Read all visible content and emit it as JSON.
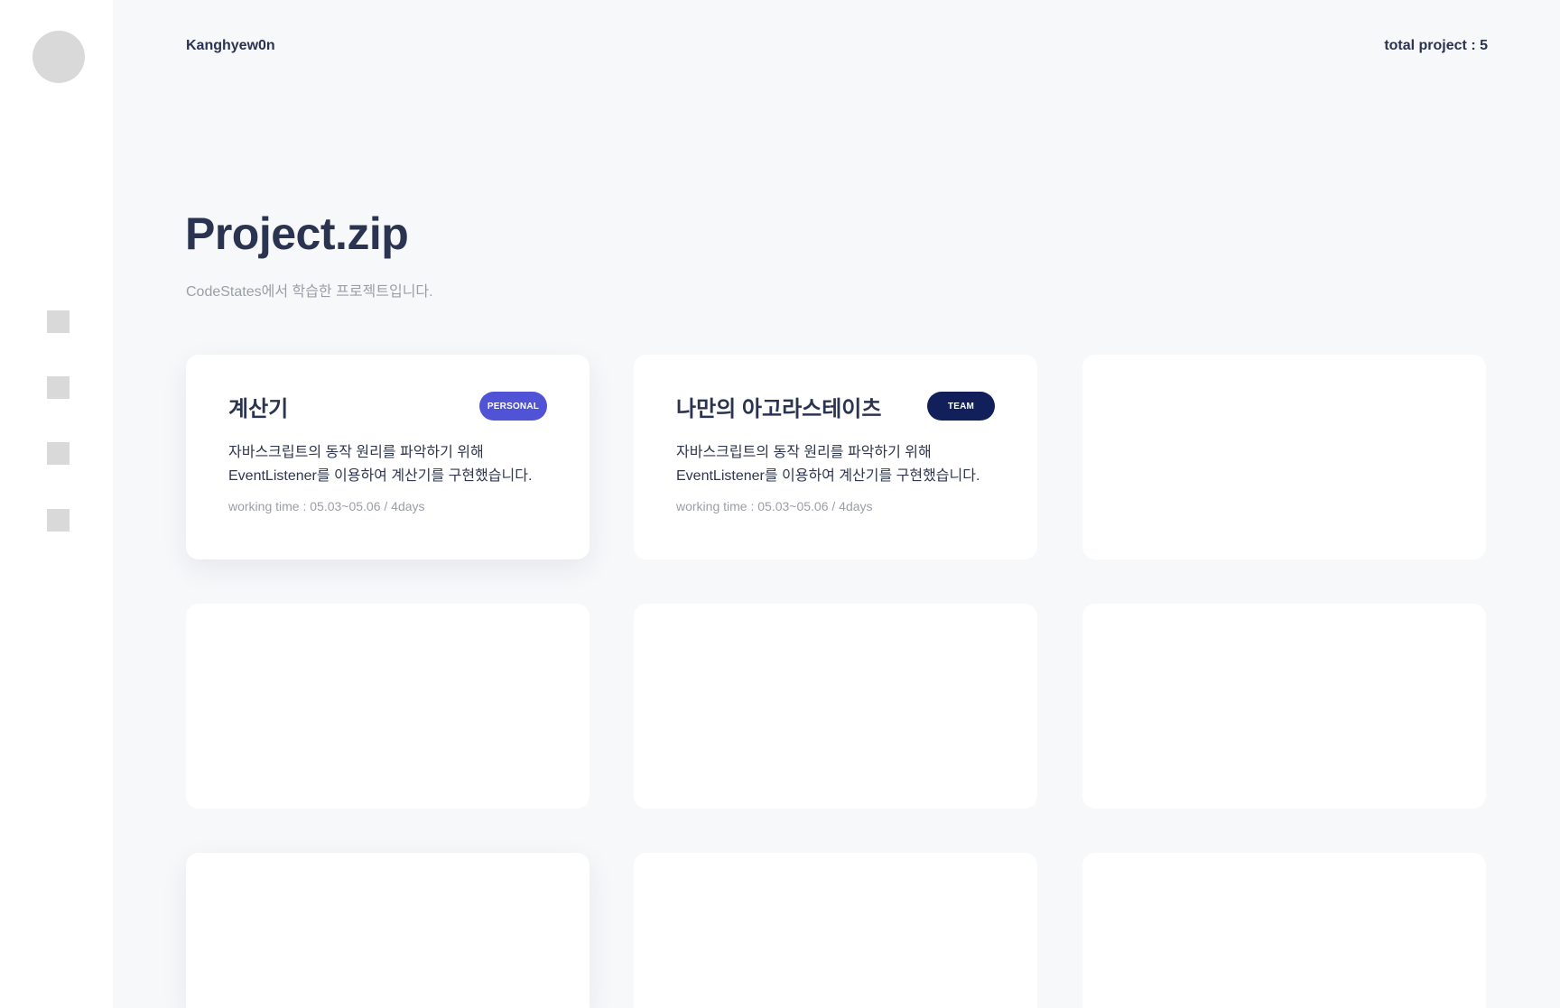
{
  "sidebar": {
    "nav_items": [
      "nav-1",
      "nav-2",
      "nav-3",
      "nav-4"
    ]
  },
  "header": {
    "brand": "Kanghyew0n",
    "total": "total project : 5"
  },
  "page": {
    "title": "Project.zip",
    "subtitle": "CodeStates에서 학습한 프로젝트입니다."
  },
  "projects": [
    {
      "title": "계산기",
      "badge": "PERSONAL",
      "badge_color": "#5053d6",
      "desc_line1": "자바스크립트의 동작 원리를 파악하기 위해",
      "desc_line2": "EventListener를 이용하여 계산기를 구현했습니다.",
      "meta": "working time : 05.03~05.06 / 4days"
    },
    {
      "title": "나만의 아고라스테이츠",
      "badge": "TEAM",
      "badge_color": "#11205a",
      "desc_line1": "자바스크립트의 동작 원리를 파악하기 위해",
      "desc_line2": "EventListener를 이용하여 계산기를 구현했습니다.",
      "meta": "working time : 05.03~05.06 / 4days"
    }
  ],
  "colors": {
    "background": "#f7f8fa",
    "card": "#ffffff",
    "text_dark": "#2a3350",
    "text_muted": "#9a9ea8",
    "placeholder": "#d9d9d9"
  }
}
